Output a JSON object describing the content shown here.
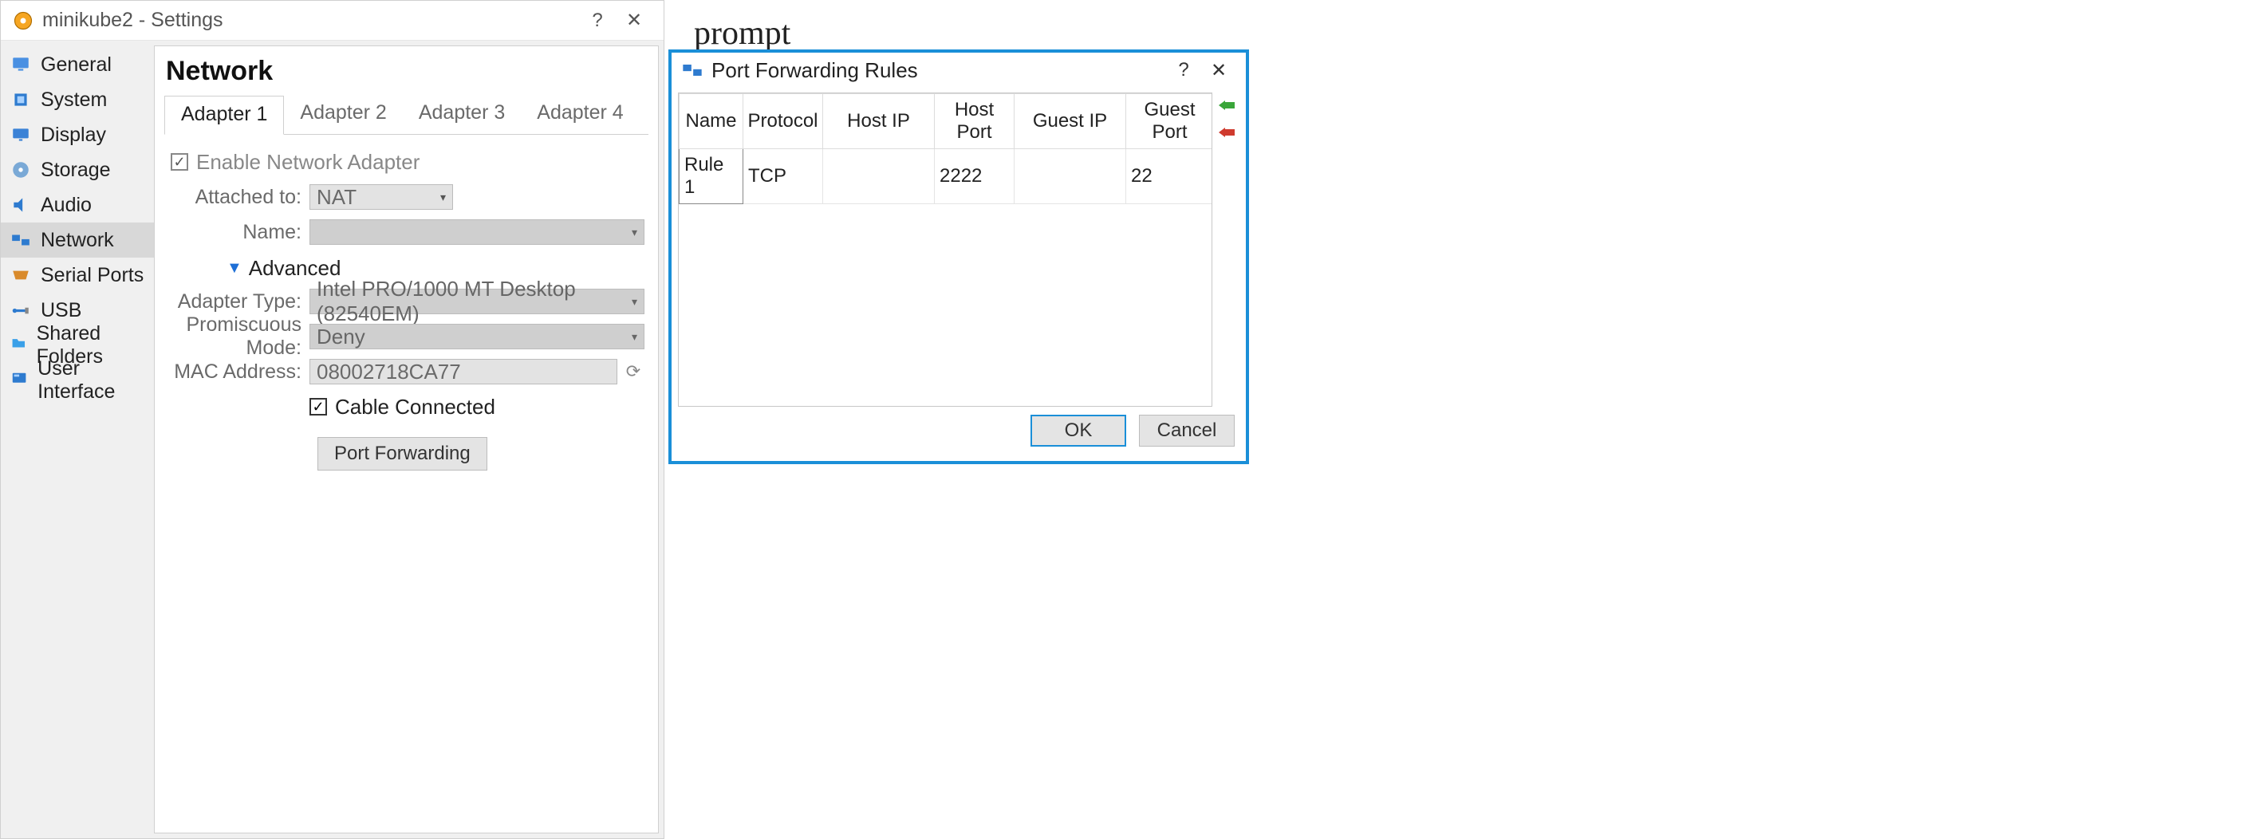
{
  "settings": {
    "window_title": "minikube2 - Settings",
    "sidebar": [
      {
        "label": "General"
      },
      {
        "label": "System"
      },
      {
        "label": "Display"
      },
      {
        "label": "Storage"
      },
      {
        "label": "Audio"
      },
      {
        "label": "Network",
        "active": true
      },
      {
        "label": "Serial Ports"
      },
      {
        "label": "USB"
      },
      {
        "label": "Shared Folders"
      },
      {
        "label": "User Interface"
      }
    ],
    "section_title": "Network",
    "tabs": [
      "Adapter 1",
      "Adapter 2",
      "Adapter 3",
      "Adapter 4"
    ],
    "active_tab": 0,
    "enable_label": "Enable Network Adapter",
    "rows": {
      "attached_to": {
        "label": "Attached to:",
        "value": "NAT"
      },
      "name": {
        "label": "Name:",
        "value": ""
      },
      "advanced": "Advanced",
      "adapter_type": {
        "label": "Adapter Type:",
        "value": "Intel PRO/1000 MT Desktop (82540EM)"
      },
      "promiscuous": {
        "label": "Promiscuous Mode:",
        "value": "Deny"
      },
      "mac": {
        "label": "MAC Address:",
        "value": "08002718CA77"
      },
      "cable": {
        "label": "Cable Connected"
      },
      "port_fwd_btn": "Port Forwarding"
    }
  },
  "bg_text": "prompt",
  "pf": {
    "title": "Port Forwarding Rules",
    "columns": [
      "Name",
      "Protocol",
      "Host IP",
      "Host Port",
      "Guest IP",
      "Guest Port"
    ],
    "rows": [
      {
        "name": "Rule 1",
        "protocol": "TCP",
        "host_ip": "",
        "host_port": "2222",
        "guest_ip": "",
        "guest_port": "22"
      }
    ],
    "ok": "OK",
    "cancel": "Cancel"
  }
}
